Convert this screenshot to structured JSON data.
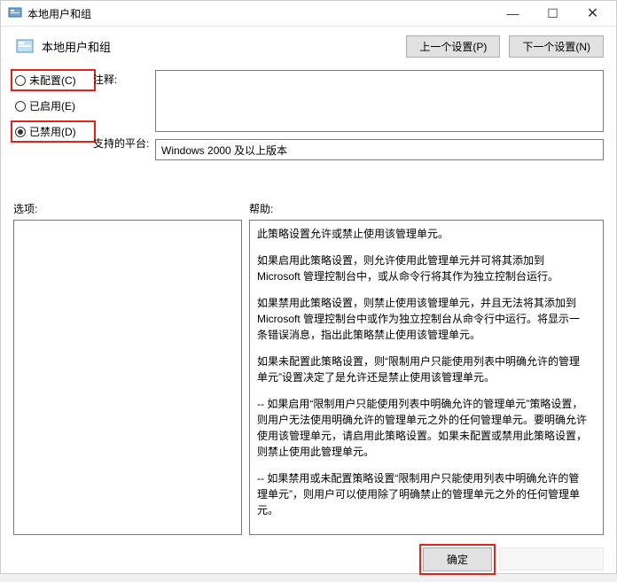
{
  "window": {
    "title": "本地用户和组"
  },
  "header": {
    "title": "本地用户和组",
    "prev_button": "上一个设置(P)",
    "next_button": "下一个设置(N)"
  },
  "radios": {
    "not_configured": "未配置(C)",
    "enabled": "已启用(E)",
    "disabled": "已禁用(D)"
  },
  "labels": {
    "comment": "注释:",
    "platform": "支持的平台:",
    "options": "选项:",
    "help": "帮助:"
  },
  "fields": {
    "comment_value": "",
    "platform_value": "Windows 2000 及以上版本"
  },
  "help": {
    "p1": "此策略设置允许或禁止使用该管理单元。",
    "p2": "如果启用此策略设置，则允许使用此管理单元并可将其添加到 Microsoft 管理控制台中，或从命令行将其作为独立控制台运行。",
    "p3": "如果禁用此策略设置，则禁止使用该管理单元，并且无法将其添加到 Microsoft 管理控制台中或作为独立控制台从命令行中运行。将显示一条错误消息，指出此策略禁止使用该管理单元。",
    "p4": "如果未配置此策略设置，则“限制用户只能使用列表中明确允许的管理单元”设置决定了是允许还是禁止使用该管理单元。",
    "p5": "--  如果启用“限制用户只能使用列表中明确允许的管理单元”策略设置，则用户无法使用明确允许的管理单元之外的任何管理单元。要明确允许使用该管理单元，请启用此策略设置。如果未配置或禁用此策略设置，则禁止使用此管理单元。",
    "p6": "--  如果禁用或未配置策略设置“限制用户只能使用列表中明确允许的管理单元”，则用户可以使用除了明确禁止的管理单元之外的任何管理单元。"
  },
  "footer": {
    "ok": "确定"
  }
}
